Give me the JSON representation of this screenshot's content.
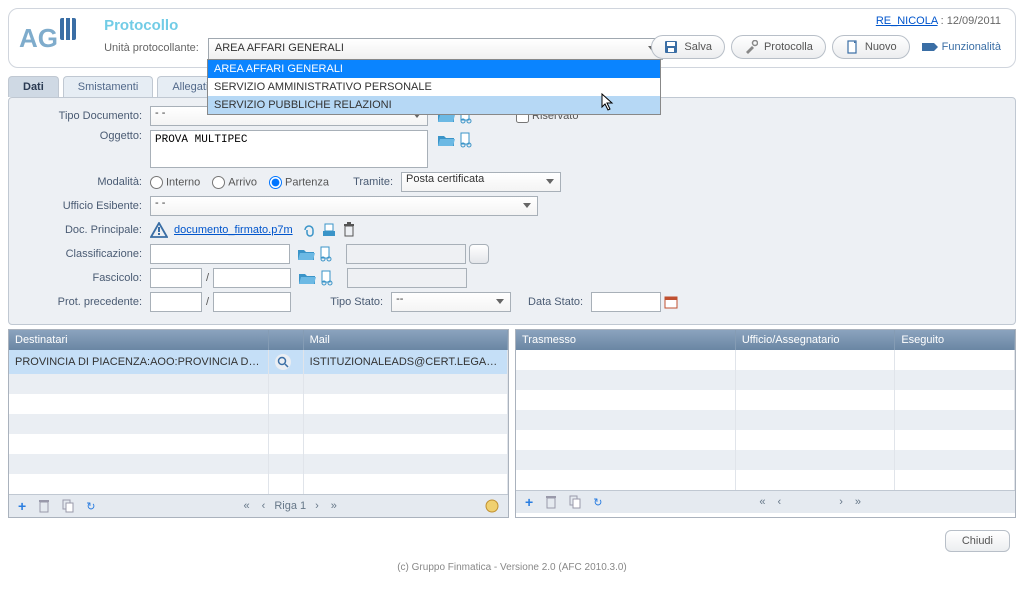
{
  "header": {
    "app_title": "Protocollo",
    "unit_label": "Unità protocollante:",
    "unit_value": "AREA AFFARI GENERALI",
    "user_link": "RE_NICOLA",
    "date": "12/09/2011",
    "buttons": {
      "save": "Salva",
      "protocolla": "Protocolla",
      "nuovo": "Nuovo",
      "funzionalita": "Funzionalità"
    },
    "dropdown_options": [
      "AREA AFFARI GENERALI",
      "SERVIZIO AMMINISTRATIVO PERSONALE",
      "SERVIZIO PUBBLICHE RELAZIONI"
    ]
  },
  "tabs": {
    "t1": "Dati",
    "t2": "Smistamenti",
    "t3": "Allegati e N"
  },
  "form": {
    "tipo_documento_lbl": "Tipo Documento:",
    "tipo_documento_val": "- -",
    "riservato_lbl": "Riservato",
    "oggetto_lbl": "Oggetto:",
    "oggetto_val": "PROVA MULTIPEC",
    "modalita_lbl": "Modalità:",
    "radio_interno": "Interno",
    "radio_arrivo": "Arrivo",
    "radio_partenza": "Partenza",
    "tramite_lbl": "Tramite:",
    "tramite_val": "Posta certificata",
    "ufficio_lbl": "Ufficio Esibente:",
    "ufficio_val": "- -",
    "doc_princ_lbl": "Doc. Principale:",
    "doc_princ_link": "documento_firmato.p7m",
    "classif_lbl": "Classificazione:",
    "fascicolo_lbl": "Fascicolo:",
    "prot_prec_lbl": "Prot. precedente:",
    "tipo_stato_lbl": "Tipo Stato:",
    "tipo_stato_val": "--",
    "data_stato_lbl": "Data Stato:",
    "slash": "/"
  },
  "grid_left": {
    "cols": {
      "c1": "Destinatari",
      "c2": "Mail"
    },
    "rows": [
      {
        "c1": "PROVINCIA DI PIACENZA:AOO:PROVINCIA DI PIA",
        "c2": "ISTITUZIONALEADS@CERT.LEGALMAIL.IT"
      },
      {
        "c1": "",
        "c2": ""
      },
      {
        "c1": "",
        "c2": ""
      },
      {
        "c1": "",
        "c2": ""
      },
      {
        "c1": "",
        "c2": ""
      },
      {
        "c1": "",
        "c2": ""
      },
      {
        "c1": "",
        "c2": ""
      }
    ],
    "foot": {
      "page": "Riga 1"
    }
  },
  "grid_right": {
    "cols": {
      "c1": "Trasmesso",
      "c2": "Ufficio/Assegnatario",
      "c3": "Eseguito"
    },
    "rows": [
      {},
      {},
      {},
      {},
      {},
      {},
      {}
    ]
  },
  "bottom": {
    "chiudi": "Chiudi"
  },
  "footer": "(c) Gruppo Finmatica - Versione 2.0 (AFC 2010.3.0)"
}
